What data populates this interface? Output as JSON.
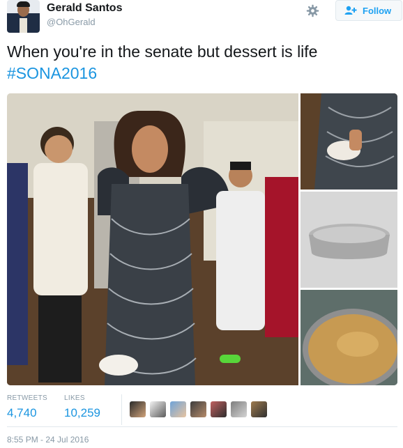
{
  "user": {
    "name": "Gerald Santos",
    "handle": "@OhGerald"
  },
  "follow_label": "Follow",
  "tweet": {
    "text": "When you're in the senate but dessert is life",
    "hashtag": "#SONA2016"
  },
  "stats": {
    "retweets_label": "RETWEETS",
    "retweets_value": "4,740",
    "likes_label": "LIKES",
    "likes_value": "10,259"
  },
  "timestamp": "8:55 PM - 24 Jul 2016",
  "colors": {
    "link_blue": "#1b95e0",
    "follow_blue": "#1da1f2",
    "muted_gray": "#8899a6"
  },
  "icons": [
    "gear-icon",
    "follow-user-icon"
  ]
}
